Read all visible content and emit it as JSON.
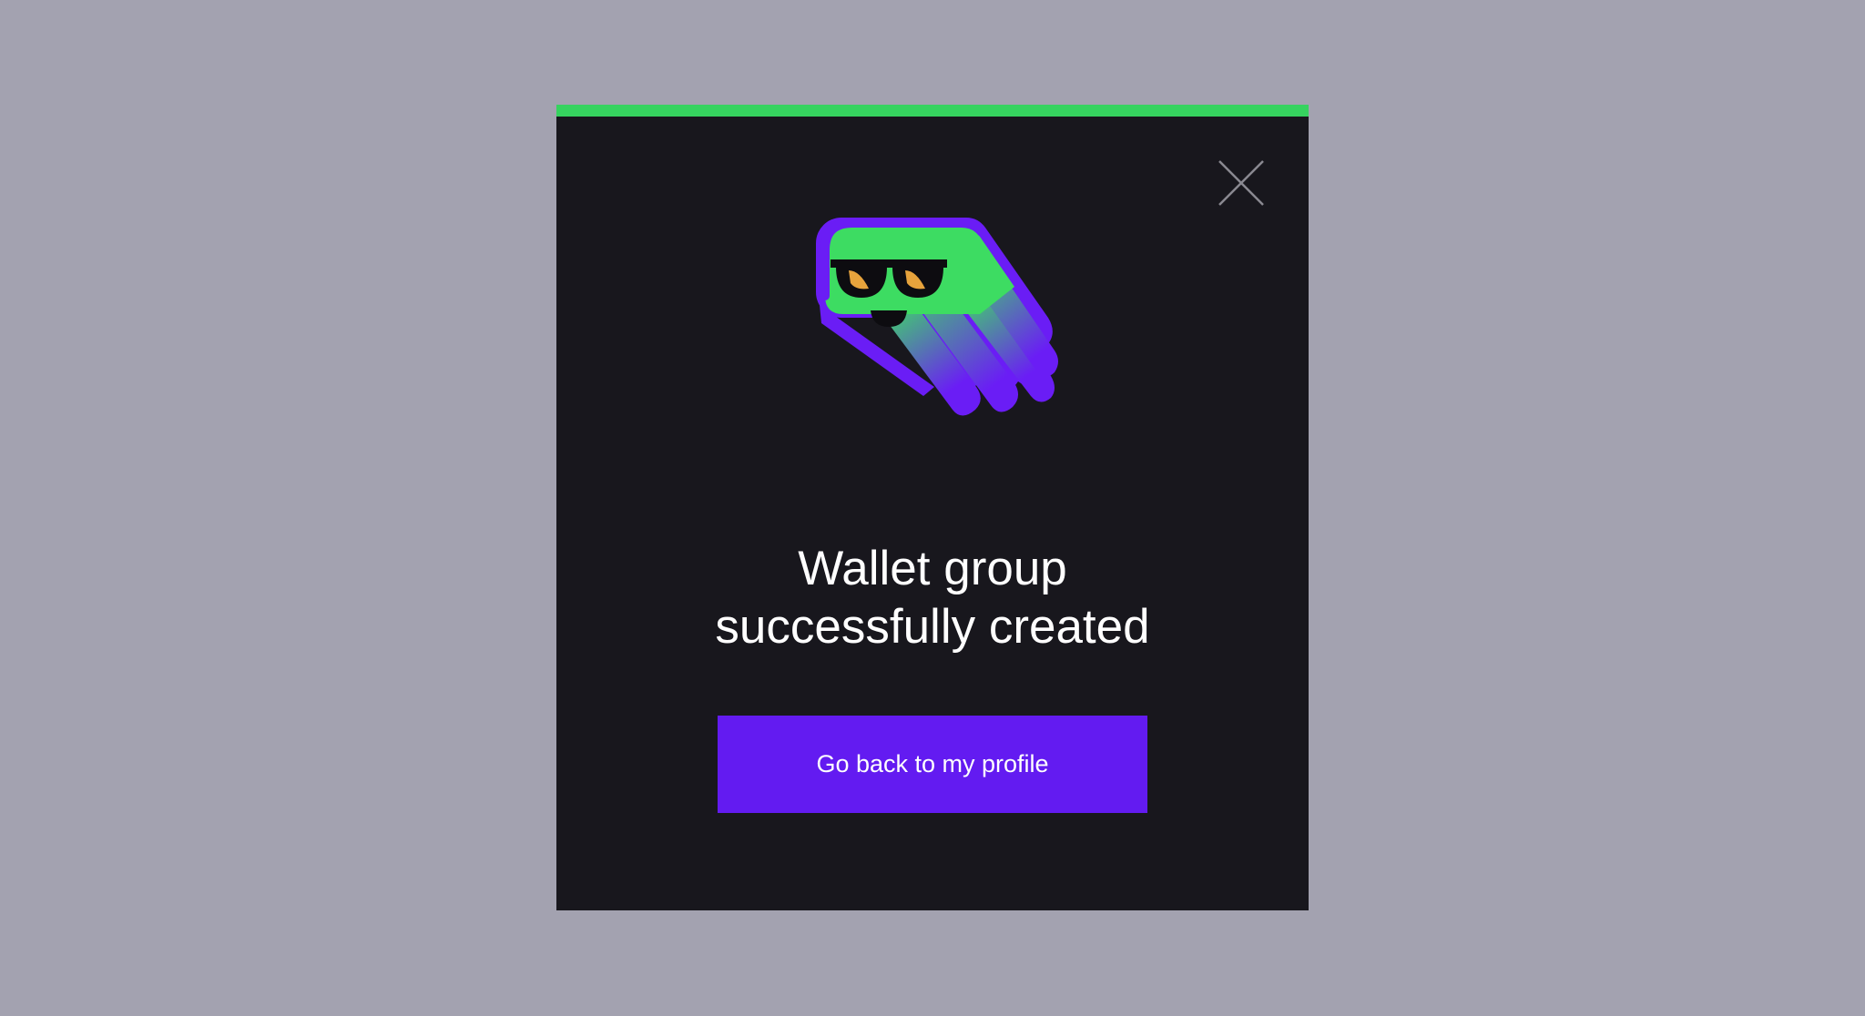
{
  "dialog": {
    "title_line1": "Wallet group",
    "title_line2": "successfully created",
    "primary_button_label": "Go back to my profile",
    "close_icon": "close-icon",
    "illustration": "ghost-mascot-with-sunglasses"
  },
  "colors": {
    "backdrop": "#a3a2b0",
    "modal_background": "#18171d",
    "accent_bar": "#36d35f",
    "button": "#631bf1",
    "mascot_green": "#3ddc62",
    "mascot_purple": "#6a1df5",
    "lens_highlight": "#e7a33c"
  }
}
